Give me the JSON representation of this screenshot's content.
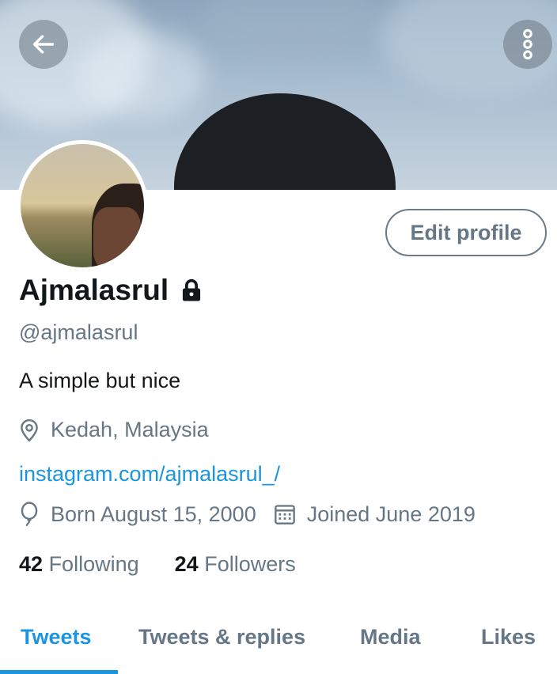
{
  "profile": {
    "name": "Ajmalasrul",
    "handle": "@ajmalasrul",
    "bio": "A simple but nice",
    "location": "Kedah, Malaysia",
    "website": "instagram.com/ajmalasrul_/",
    "born": "Born August 15, 2000",
    "joined": "Joined June 2019",
    "protected": true
  },
  "buttons": {
    "edit_profile": "Edit profile"
  },
  "stats": {
    "following_count": "42",
    "following_label": "Following",
    "followers_count": "24",
    "followers_label": "Followers"
  },
  "tabs": [
    {
      "label": "Tweets",
      "active": true
    },
    {
      "label": "Tweets & replies",
      "active": false
    },
    {
      "label": "Media",
      "active": false
    },
    {
      "label": "Likes",
      "active": false
    }
  ],
  "icons": {
    "back": "arrow-left-icon",
    "more": "more-vertical-icon",
    "lock": "lock-icon",
    "location": "location-pin-icon",
    "birthday": "balloon-icon",
    "joined": "calendar-icon"
  },
  "colors": {
    "accent": "#1b95e0",
    "secondary_text": "#657786",
    "primary_text": "#14171a"
  }
}
